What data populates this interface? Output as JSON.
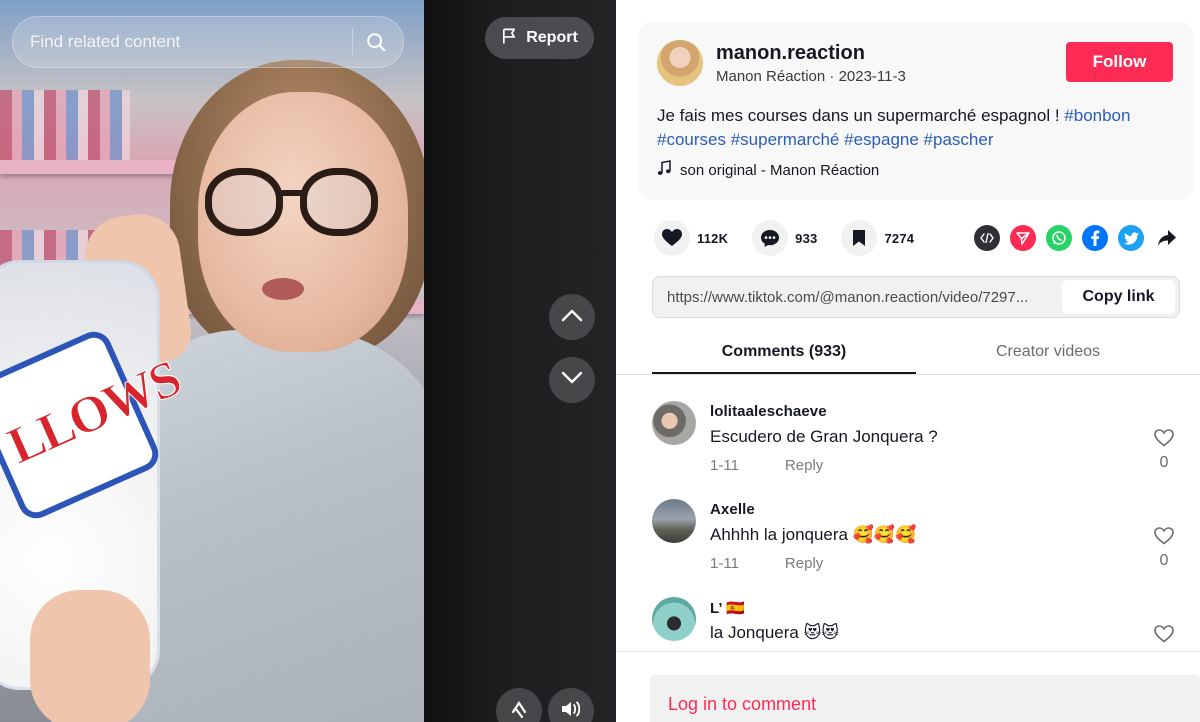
{
  "video": {
    "search_placeholder": "Find related content",
    "report_label": "Report",
    "bag_text": "LLOWS"
  },
  "author": {
    "username": "manon.reaction",
    "subtitle": "Manon Réaction · 2023-11-3",
    "follow_label": "Follow",
    "description_text": "Je fais mes courses dans un supermarché espagnol ! ",
    "hashtags": [
      "#bonbon",
      "#courses",
      "#supermarché",
      "#espagne",
      "#pascher"
    ],
    "music": "son original - Manon Réaction"
  },
  "stats": {
    "likes": "112K",
    "comments": "933",
    "saves": "7274"
  },
  "share": {
    "icons": [
      "embed-icon",
      "send-icon",
      "whatsapp-icon",
      "facebook-icon",
      "twitter-icon",
      "share-arrow-icon"
    ],
    "colors": {
      "embed": "#2f3036",
      "send": "#fe2c55",
      "whatsapp": "#25d366",
      "facebook": "#0075fa",
      "twitter": "#1da1f2"
    }
  },
  "link": {
    "url": "https://www.tiktok.com/@manon.reaction/video/7297...",
    "copy_label": "Copy link"
  },
  "tabs": [
    {
      "label": "Comments (933)",
      "active": true
    },
    {
      "label": "Creator videos",
      "active": false
    }
  ],
  "comments": [
    {
      "user": "lolitaaleschaeve",
      "text": "Escudero de Gran Jonquera ?",
      "date": "1-11",
      "reply": "Reply",
      "likes": "0"
    },
    {
      "user": "Axelle",
      "text": "Ahhhh la jonquera 🥰🥰🥰",
      "date": "1-11",
      "reply": "Reply",
      "likes": "0"
    },
    {
      "user": "L’ 🇪🇸",
      "text": "la Jonquera 😻😻",
      "date": "",
      "reply": "",
      "likes": ""
    }
  ],
  "login": {
    "label": "Log in to comment"
  },
  "colors": {
    "accent": "#fe2c55",
    "hashtag": "#2b5db9"
  }
}
